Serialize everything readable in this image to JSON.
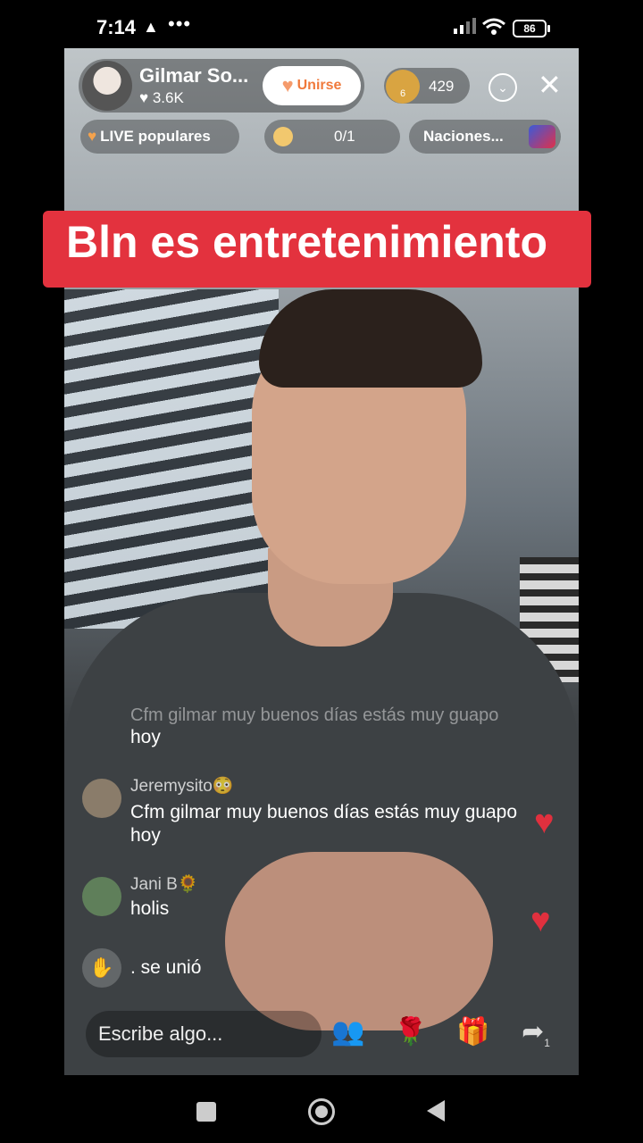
{
  "status_bar": {
    "time": "7:14",
    "warning_glyph": "▲",
    "more_glyph": "•••",
    "battery": "86"
  },
  "header": {
    "host_name": "Gilmar So...",
    "host_likes": "3.6K",
    "join_label": "Unirse",
    "viewer_badge": "6",
    "viewer_count": "429"
  },
  "chips": {
    "live_label": "LIVE populares",
    "goal_value": "0/1",
    "nations_label": "Naciones..."
  },
  "banner": {
    "text": "Bln es entretenimiento"
  },
  "chat": {
    "faded_line": "Cfm gilmar muy buenos días estás muy guapo",
    "faded_line_2": "hoy",
    "messages": [
      {
        "user": "Jeremysito😳",
        "text_1": "Cfm gilmar muy buenos días estás muy guapo",
        "text_2": "hoy"
      },
      {
        "user": "Jani B🌻",
        "text_1": "holis"
      }
    ],
    "join_text": ". se unió"
  },
  "bottom": {
    "input_placeholder": "Escribe algo...",
    "share_count": "1"
  },
  "colors": {
    "banner": "#e3323e",
    "heart": "#e0303e",
    "join_text": "#f07a3c"
  },
  "icons": [
    "warning-icon",
    "signal-icon",
    "wifi-icon",
    "battery-icon",
    "chevron-down-icon",
    "close-icon",
    "heart-icon",
    "planet-icon",
    "wave-icon",
    "guests-icon",
    "rose-icon",
    "gift-icon",
    "share-icon"
  ]
}
